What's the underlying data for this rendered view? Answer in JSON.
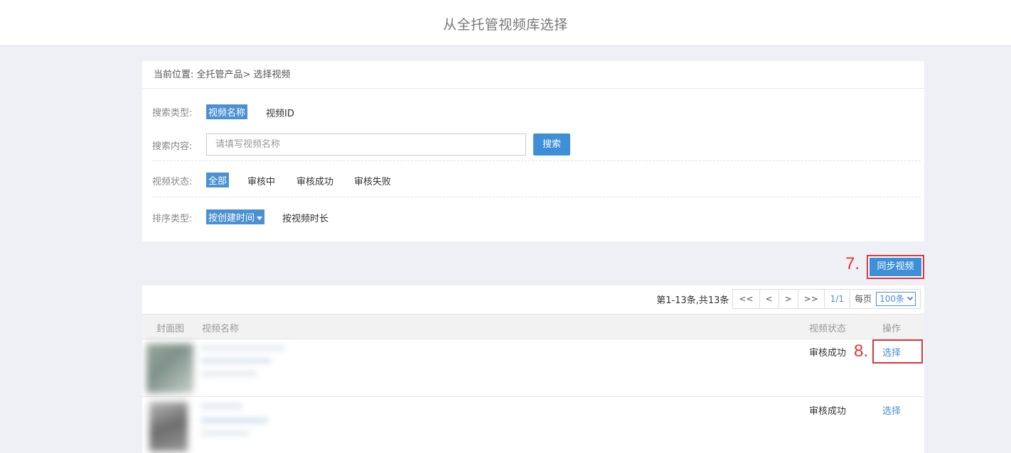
{
  "header": {
    "title": "从全托管视频库选择"
  },
  "breadcrumb": {
    "label": "当前位置:",
    "path": "全托管产品> 选择视频"
  },
  "filters": {
    "search_type": {
      "label": "搜索类型:",
      "options": [
        "视频名称",
        "视频ID"
      ],
      "selected": "视频名称"
    },
    "search_content": {
      "label": "搜索内容:",
      "placeholder": "请填写视频名称",
      "button": "搜索"
    },
    "video_status": {
      "label": "视频状态:",
      "options": [
        "全部",
        "审核中",
        "审核成功",
        "审核失败"
      ],
      "selected": "全部"
    },
    "sort_type": {
      "label": "排序类型:",
      "options": [
        "按创建时间",
        "按视频时长"
      ],
      "selected": "按创建时间"
    }
  },
  "annotations": {
    "step7": "7.",
    "step8": "8."
  },
  "sync_button": "同步视频",
  "pagination": {
    "info": "第1-13条,共13条",
    "buttons": [
      "<<",
      "<",
      ">",
      ">>"
    ],
    "page": "1/1",
    "per_page_label": "每页",
    "per_page_value": "100条"
  },
  "table": {
    "columns": {
      "cover": "封面图",
      "name": "视频名称",
      "status": "视频状态",
      "action": "操作"
    },
    "rows": [
      {
        "status": "审核成功",
        "action": "选择"
      },
      {
        "status": "审核成功",
        "action": "选择"
      }
    ]
  },
  "colors": {
    "accent": "#4a90d2",
    "highlight": "#d9363e"
  }
}
